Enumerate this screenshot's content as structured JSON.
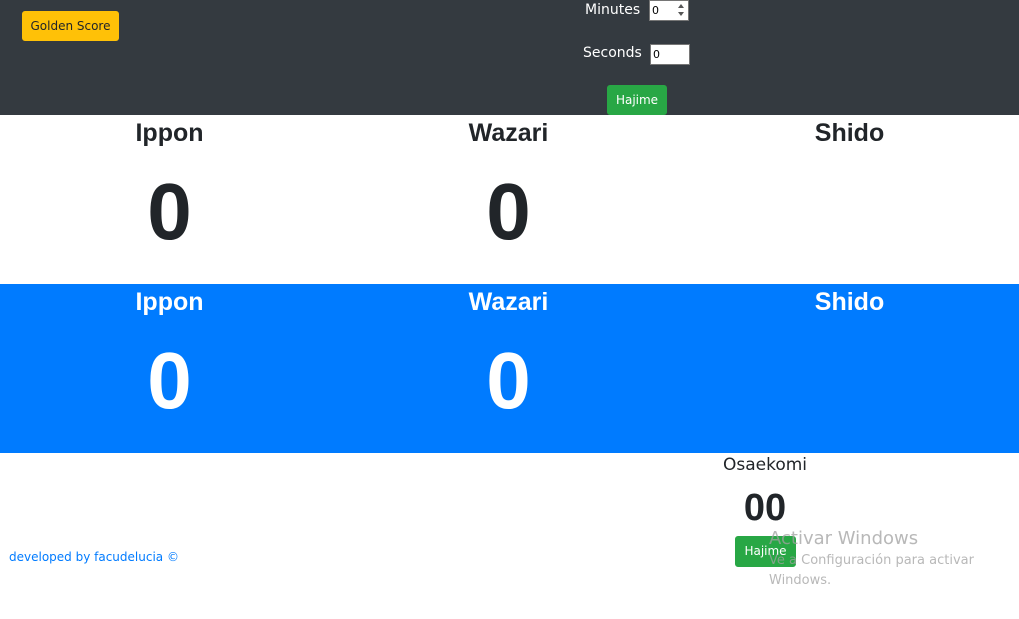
{
  "topbar": {
    "golden_score_label": "Golden Score",
    "minutes_label": "Minutes",
    "minutes_value": "0",
    "seconds_label": "Seconds",
    "seconds_value": "0",
    "hajime_label": "Hajime"
  },
  "white_panel": {
    "ippon_label": "Ippon",
    "ippon_value": "0",
    "wazari_label": "Wazari",
    "wazari_value": "0",
    "shido_label": "Shido"
  },
  "blue_panel": {
    "ippon_label": "Ippon",
    "ippon_value": "0",
    "wazari_label": "Wazari",
    "wazari_value": "0",
    "shido_label": "Shido"
  },
  "osaekomi": {
    "title": "Osaekomi",
    "value": "00",
    "hajime_label": "Hajime"
  },
  "footer": {
    "credit": "developed by facudelucia ©"
  },
  "watermark": {
    "title": "Activar Windows",
    "subtitle": "Ve a Configuración para activar Windows."
  },
  "colors": {
    "topbar": "#343a40",
    "golden": "#ffc107",
    "green": "#28a745",
    "blue": "#007bff",
    "text_dark": "#212529"
  }
}
